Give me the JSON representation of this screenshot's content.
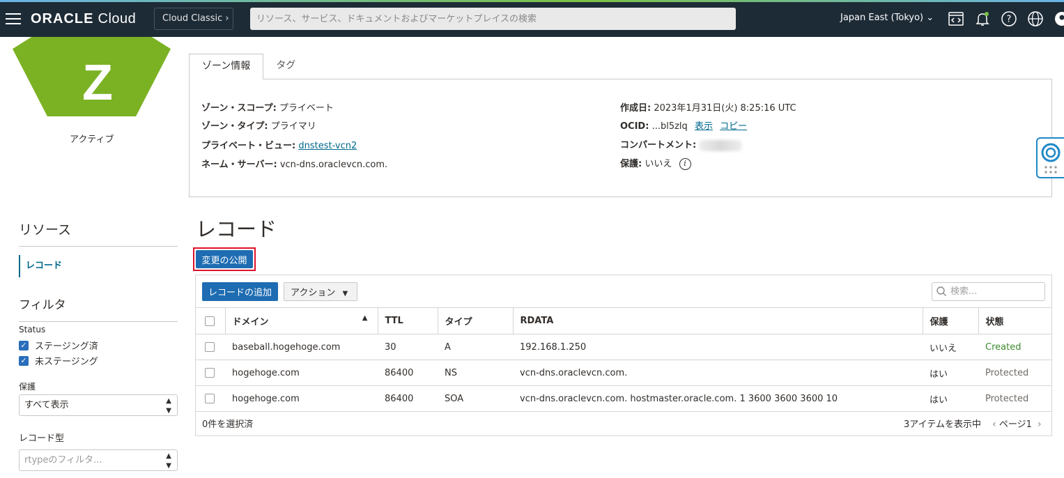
{
  "header": {
    "logo_bold": "ORACLE",
    "logo_light": "Cloud",
    "cloud_classic": "Cloud Classic",
    "search_placeholder": "リソース、サービス、ドキュメントおよびマーケットプレイスの検索",
    "region": "Japan East (Tokyo)",
    "icons": [
      "code-editor-icon",
      "bell-icon",
      "help-icon",
      "globe-icon",
      "user-icon"
    ]
  },
  "zone": {
    "letter": "Z",
    "status": "アクティブ",
    "color": "#7bb224"
  },
  "tabs": [
    {
      "label": "ゾーン情報"
    },
    {
      "label": "タグ"
    }
  ],
  "info": {
    "scope_label": "ゾーン・スコープ:",
    "scope_value": "プライベート",
    "type_label": "ゾーン・タイプ:",
    "type_value": "プライマリ",
    "view_label": "プライベート・ビュー:",
    "view_value": "dnstest-vcn2",
    "ns_label": "ネーム・サーバー:",
    "ns_value": "vcn-dns.oraclevcn.com.",
    "created_label": "作成日:",
    "created_value": "2023年1月31日(火) 8:25:16 UTC",
    "ocid_label": "OCID:",
    "ocid_value": "...bl5zlq",
    "ocid_show": "表示",
    "ocid_copy": "コピー",
    "compartment_label": "コンパートメント:",
    "protected_label": "保護:",
    "protected_value": "いいえ"
  },
  "sidebar": {
    "resources_title": "リソース",
    "resource_item": "レコード",
    "filter_title": "フィルタ",
    "status_label": "Status",
    "status_options": [
      "ステージング済",
      "未ステージング"
    ],
    "protect_label": "保護",
    "protect_value": "すべて表示",
    "record_type_label": "レコード型",
    "record_type_placeholder": "rtypeのフィルタ..."
  },
  "main": {
    "title": "レコード",
    "publish_button": "変更の公開",
    "add_button": "レコードの追加",
    "action_button": "アクション",
    "search_placeholder": "検索..."
  },
  "table": {
    "headers": [
      "ドメイン",
      "TTL",
      "タイプ",
      "RDATA",
      "保護",
      "状態"
    ],
    "rows": [
      {
        "domain": "baseball.hogehoge.com",
        "ttl": "30",
        "type": "A",
        "rdata": "192.168.1.250",
        "protected": "いいえ",
        "state": "Created"
      },
      {
        "domain": "hogehoge.com",
        "ttl": "86400",
        "type": "NS",
        "rdata": "vcn-dns.oraclevcn.com.",
        "protected": "はい",
        "state": "Protected"
      },
      {
        "domain": "hogehoge.com",
        "ttl": "86400",
        "type": "SOA",
        "rdata": "vcn-dns.oraclevcn.com. hostmaster.oracle.com. 1 3600 3600 3600 10",
        "protected": "はい",
        "state": "Protected"
      }
    ],
    "selected_count": "0件を選択済",
    "items_shown": "3アイテムを表示中",
    "page": "ページ1"
  },
  "colors": {
    "header_bg": "#1d2b36",
    "primary_button": "#1e6cb2",
    "highlight_outline": "#e0112b",
    "link": "#00688c"
  }
}
